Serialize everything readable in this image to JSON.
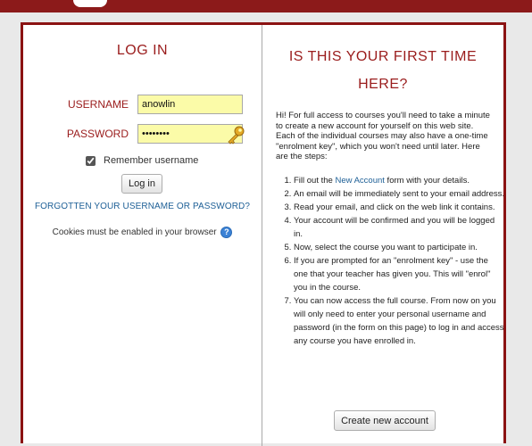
{
  "login": {
    "title": "LOG IN",
    "username_label": "USERNAME",
    "username_value": "anowlin",
    "password_label": "PASSWORD",
    "password_value": "********",
    "remember_label": "Remember username",
    "remember_checked": true,
    "login_button": "Log in",
    "forgot_link": "FORGOTTEN YOUR USERNAME OR PASSWORD?",
    "cookies_text": "Cookies must be enabled in your browser",
    "help_glyph": "?"
  },
  "signup": {
    "title": "IS THIS YOUR FIRST TIME HERE?",
    "intro": "Hi! For full access to courses you'll need to take a minute to create a new account for yourself on this web site. Each of the individual courses may also have a one-time \"enrolment key\", which you won't need until later. Here are the steps:",
    "step1_prefix": "Fill out the ",
    "step1_link": "New Account",
    "step1_suffix": " form with your details.",
    "steps": [
      "An email will be immediately sent to your email address.",
      "Read your email, and click on the web link it contains.",
      "Your account will be confirmed and you will be logged in.",
      "Now, select the course you want to participate in.",
      "If you are prompted for an \"enrolment key\" - use the one that your teacher has given you. This will \"enrol\" you in the course.",
      "You can now access the full course. From now on you will only need to enter your personal username and password (in the form on this page) to log in and access any course you have enrolled in."
    ],
    "create_button": "Create new account"
  },
  "colors": {
    "brand": "#8b1212",
    "heading": "#9a1c1c",
    "link": "#1d5f96",
    "input_bg": "#fbfba8"
  },
  "icons": {
    "password_field": "key-icon",
    "cookies_help": "help-icon"
  }
}
